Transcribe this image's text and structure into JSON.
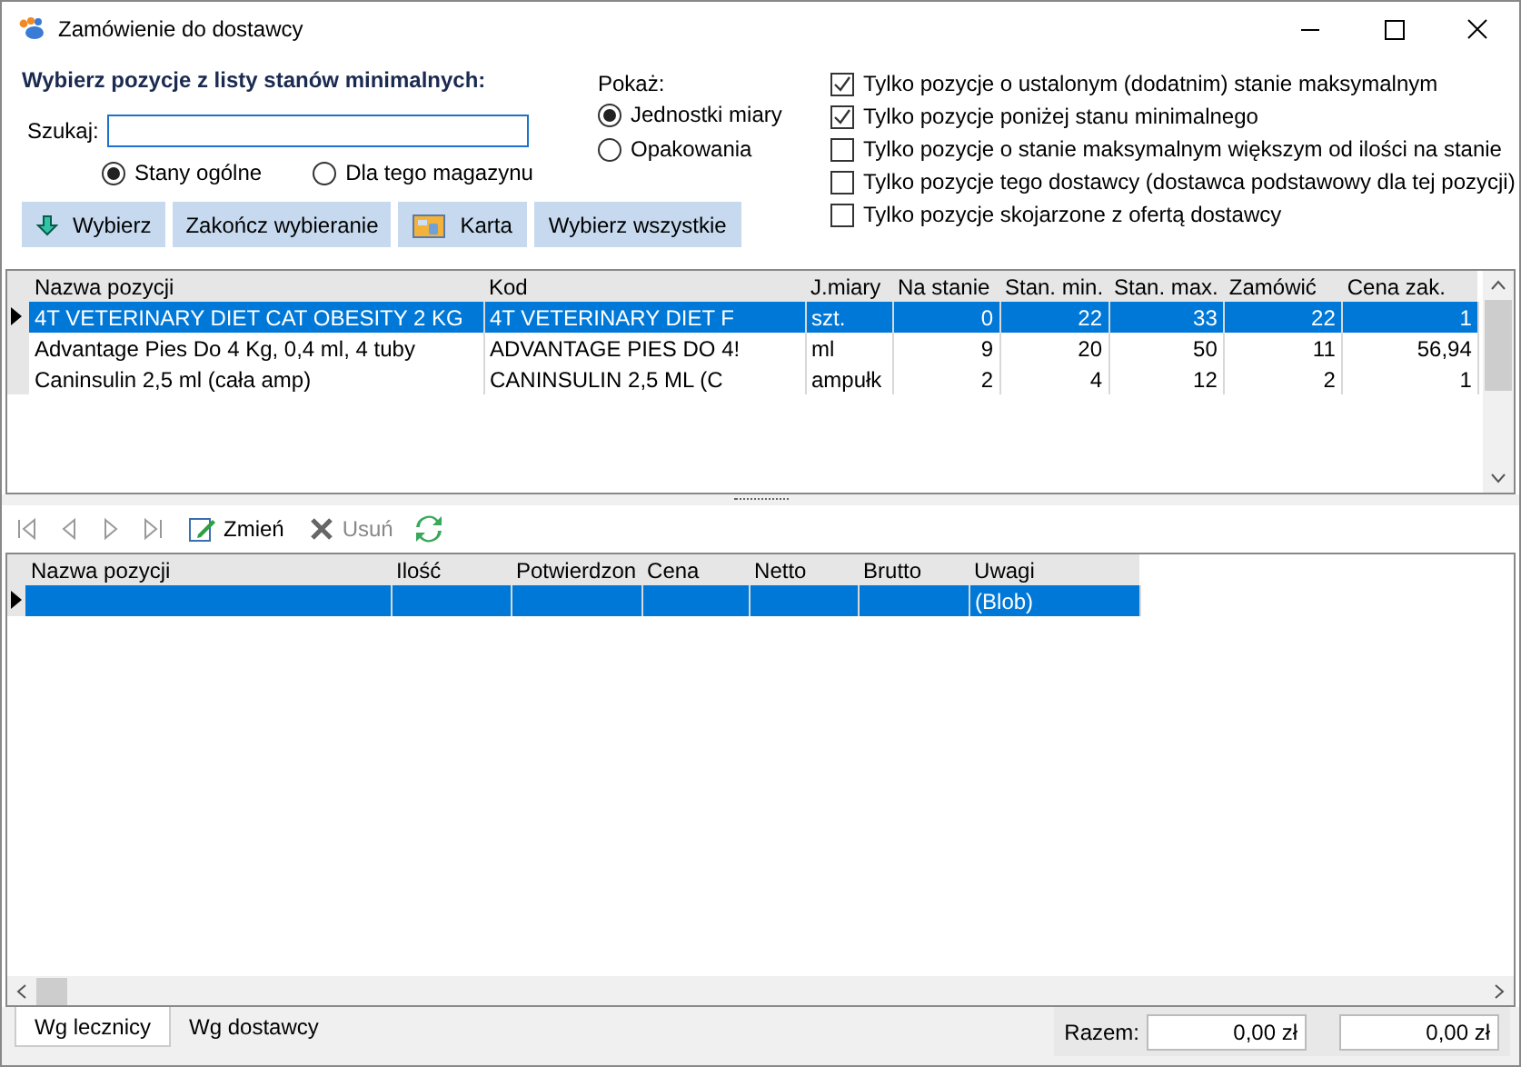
{
  "window": {
    "title": "Zamówienie do dostawcy"
  },
  "header": {
    "label": "Wybierz pozycje z listy stanów minimalnych:"
  },
  "search": {
    "label": "Szukaj:"
  },
  "scope": [
    {
      "label": "Stany ogólne",
      "selected": true
    },
    {
      "label": "Dla tego magazynu",
      "selected": false
    }
  ],
  "show": {
    "label": "Pokaż:",
    "options": [
      {
        "label": "Jednostki miary",
        "selected": true
      },
      {
        "label": "Opakowania",
        "selected": false
      }
    ]
  },
  "filters": [
    {
      "label": "Tylko pozycje o ustalonym (dodatnim) stanie maksymalnym",
      "checked": true
    },
    {
      "label": "Tylko pozycje poniżej stanu minimalnego",
      "checked": true
    },
    {
      "label": "Tylko pozycje o stanie maksymalnym większym od ilości na stanie",
      "checked": false
    },
    {
      "label": "Tylko pozycje tego dostawcy (dostawca podstawowy dla tej pozycji)",
      "checked": false
    },
    {
      "label": "Tylko pozycje skojarzone z ofertą dostawcy",
      "checked": false
    }
  ],
  "buttons": [
    {
      "label": "Wybierz",
      "kind": "arrow"
    },
    {
      "label": "Zakończ wybieranie",
      "kind": "plain"
    },
    {
      "label": "Karta",
      "kind": "card"
    },
    {
      "label": "Wybierz wszystkie",
      "kind": "plain"
    }
  ],
  "stock_table": {
    "columns": [
      "Nazwa pozycji",
      "Kod",
      "J.miary",
      "Na stanie",
      "Stan. min.",
      "Stan. max.",
      "Zamówić",
      "Cena zak."
    ],
    "rows": [
      {
        "selected": true,
        "cells": [
          "4T VETERINARY DIET CAT OBESITY 2 KG",
          "4T VETERINARY DIET F",
          "szt.",
          "0",
          "22",
          "33",
          "22",
          "1"
        ]
      },
      {
        "selected": false,
        "cells": [
          "Advantage Pies Do 4 Kg, 0,4 ml, 4 tuby",
          "ADVANTAGE PIES DO 4!",
          "ml",
          "9",
          "20",
          "50",
          "11",
          "56,94"
        ]
      },
      {
        "selected": false,
        "cells": [
          "Caninsulin 2,5 ml (cała amp)",
          "CANINSULIN 2,5 ML (C",
          "ampułk",
          "2",
          "4",
          "12",
          "2",
          "1"
        ]
      }
    ]
  },
  "toolbar": [
    {
      "label": "Zmień",
      "disabled": false
    },
    {
      "label": "Usuń",
      "disabled": true
    }
  ],
  "order_table": {
    "columns": [
      "Nazwa pozycji",
      "Ilość",
      "Potwierdzon",
      "Cena",
      "Netto",
      "Brutto",
      "Uwagi"
    ],
    "rows": [
      {
        "selected": true,
        "notes": "(Blob)"
      }
    ]
  },
  "tabs": [
    {
      "label": "Wg lecznicy",
      "selected": true
    },
    {
      "label": "Wg dostawcy",
      "selected": false
    }
  ],
  "totals": {
    "label": "Razem:",
    "values": [
      "0,00 zł",
      "0,00 zł"
    ]
  }
}
